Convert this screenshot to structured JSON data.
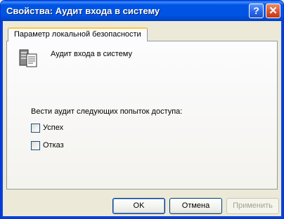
{
  "window": {
    "title": "Свойства: Аудит входа в систему",
    "help_glyph": "?",
    "close_glyph": "✕"
  },
  "tabs": [
    {
      "label": "Параметр локальной безопасности",
      "selected": true
    }
  ],
  "policy": {
    "icon": "security-policy-icon",
    "name": "Аудит входа в систему"
  },
  "audit": {
    "label": "Вести аудит следующих попыток доступа:",
    "options": [
      {
        "label": "Успех",
        "checked": false
      },
      {
        "label": "Отказ",
        "checked": false
      }
    ]
  },
  "buttons": {
    "ok": "OK",
    "cancel": "Отмена",
    "apply": "Применить",
    "apply_enabled": false
  },
  "colors": {
    "titlebar": "#0054e3",
    "dialog_bg": "#ece9d8",
    "tab_highlight": "#ffc83c",
    "close_button": "#d6522f"
  }
}
